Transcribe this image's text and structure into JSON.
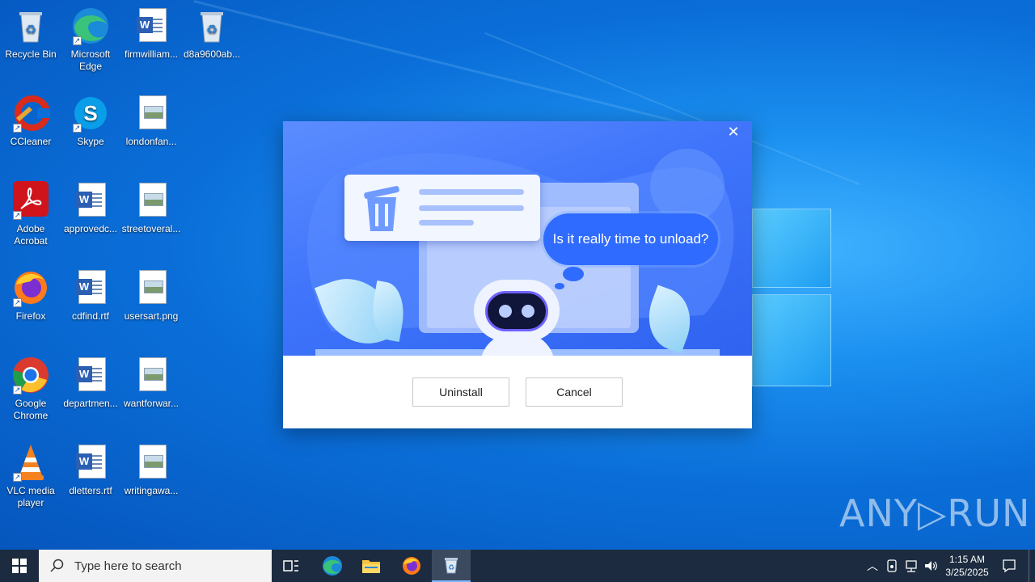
{
  "desktop": {
    "icons": [
      {
        "label": "Recycle Bin",
        "icon": "recycle-bin-icon"
      },
      {
        "label": "Microsoft Edge",
        "icon": "edge-icon"
      },
      {
        "label": "firmwilliam...",
        "icon": "word-document-icon"
      },
      {
        "label": "d8a9600ab...",
        "icon": "recycle-bin-icon"
      },
      {
        "label": "CCleaner",
        "icon": "ccleaner-icon"
      },
      {
        "label": "Skype",
        "icon": "skype-icon"
      },
      {
        "label": "londonfan...",
        "icon": "image-file-icon"
      },
      {
        "label": "Adobe Acrobat",
        "icon": "acrobat-icon"
      },
      {
        "label": "approvedc...",
        "icon": "word-document-icon"
      },
      {
        "label": "streetoveral...",
        "icon": "image-file-icon"
      },
      {
        "label": "Firefox",
        "icon": "firefox-icon"
      },
      {
        "label": "cdfind.rtf",
        "icon": "word-document-icon"
      },
      {
        "label": "usersart.png",
        "icon": "image-file-icon"
      },
      {
        "label": "Google Chrome",
        "icon": "chrome-icon"
      },
      {
        "label": "departmen...",
        "icon": "word-document-icon"
      },
      {
        "label": "wantforwar...",
        "icon": "image-file-icon"
      },
      {
        "label": "VLC media player",
        "icon": "vlc-icon"
      },
      {
        "label": "dletters.rtf",
        "icon": "word-document-icon"
      },
      {
        "label": "writingawa...",
        "icon": "image-file-icon"
      }
    ]
  },
  "dialog": {
    "bubble_text": "Is it really time to unload?",
    "uninstall_label": "Uninstall",
    "cancel_label": "Cancel",
    "close_glyph": "✕"
  },
  "watermark": {
    "text": "ANY▷RUN"
  },
  "taskbar": {
    "search_placeholder": "Type here to search",
    "time": "1:15 AM",
    "date": "3/25/2025",
    "pinned": [
      "task-view-icon",
      "edge-icon",
      "file-explorer-icon",
      "firefox-icon",
      "uninstaller-icon"
    ]
  },
  "colors": {
    "desktop_blue": "#0b6fd9",
    "taskbar": "#1c2b3f",
    "dialog_banner": "#3f74fb",
    "bubble": "#2f6bff"
  }
}
